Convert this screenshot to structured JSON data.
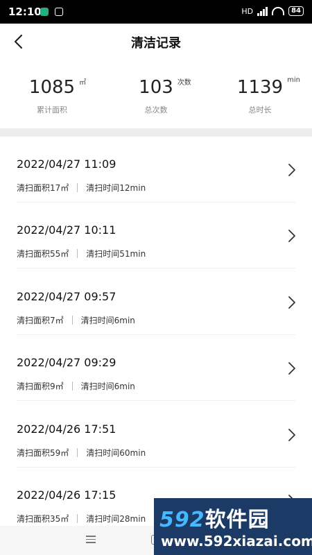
{
  "status_bar": {
    "time": "12:10",
    "network": "HD",
    "battery": "84"
  },
  "nav": {
    "title": "清洁记录",
    "back_icon": "chevron-left-icon"
  },
  "stats": [
    {
      "value": "1085",
      "unit": "㎡",
      "label": "累计面积"
    },
    {
      "value": "103",
      "unit": "次数",
      "label": "总次数"
    },
    {
      "value": "1139",
      "unit": "min",
      "label": "总时长"
    }
  ],
  "records": [
    {
      "datetime": "2022/04/27 11:09",
      "area": "清扫面积17㎡",
      "duration": "清扫时间12min"
    },
    {
      "datetime": "2022/04/27 10:11",
      "area": "清扫面积55㎡",
      "duration": "清扫时间51min"
    },
    {
      "datetime": "2022/04/27 09:57",
      "area": "清扫面积7㎡",
      "duration": "清扫时间6min"
    },
    {
      "datetime": "2022/04/27 09:29",
      "area": "清扫面积9㎡",
      "duration": "清扫时间6min"
    },
    {
      "datetime": "2022/04/26 17:51",
      "area": "清扫面积59㎡",
      "duration": "清扫时间60min"
    },
    {
      "datetime": "2022/04/26 17:15",
      "area": "清扫面积35㎡",
      "duration": "清扫时间28min"
    }
  ],
  "watermark": {
    "brand_num": "592",
    "brand_text": "软件园",
    "url": "www.592xiazai.com"
  },
  "colors": {
    "accent_blue": "#45b8ff",
    "watermark_bg": "#1b3a66",
    "divider": "#ececec"
  }
}
